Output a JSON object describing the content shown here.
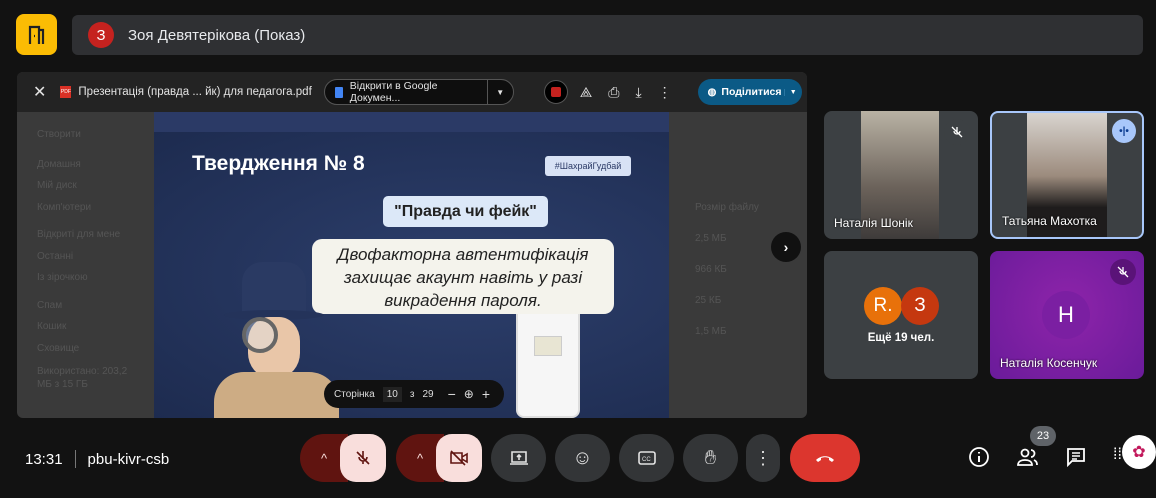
{
  "header": {
    "presenter_initial": "З",
    "title": "Зоя Девятерікова (Показ)",
    "accent": "#fbbc04"
  },
  "viewer": {
    "file_name": "Презентація (правда ... йк) для педагога.pdf",
    "open_with": "Відкрити в Google Докумен...",
    "share_label": "Поділитися",
    "page_label": "Сторінка",
    "page_current": "10",
    "page_of": "з",
    "page_total": "29",
    "bg_sidebar": [
      "Створити",
      "Домашня",
      "Мій диск",
      "Комп'ютери",
      "Відкриті для мене",
      "Останні",
      "Із зірочкою",
      "Спам",
      "Кошик",
      "Сховище",
      "Використано: 203,2 МБ з 15 ГБ"
    ],
    "bg_list": [
      "Розмір файлу",
      "2,5 МБ",
      "966 КБ",
      "25 КБ",
      "1,5 МБ"
    ]
  },
  "slide": {
    "title": "Твердження № 8",
    "hashtag": "#ШахрайГудбай",
    "subtitle": "\"Правда чи фейк\"",
    "statement": "Двофакторна автентифікація захищає акаунт навіть у разі викрадення пароля."
  },
  "participants": [
    {
      "name": "Наталія Шонік",
      "muted": true
    },
    {
      "name": "Татьяна Махотка",
      "speaking": true
    },
    {
      "more_initials": [
        "R.",
        "З"
      ],
      "more_label": "Ещё 19 чел."
    },
    {
      "name": "Наталія Косенчук",
      "initial": "Н",
      "muted": true,
      "color": "#7b1fa2"
    }
  ],
  "footer": {
    "time": "13:31",
    "meeting_code": "pbu-kivr-csb",
    "people_count": "23",
    "end_color": "#dc362e"
  }
}
